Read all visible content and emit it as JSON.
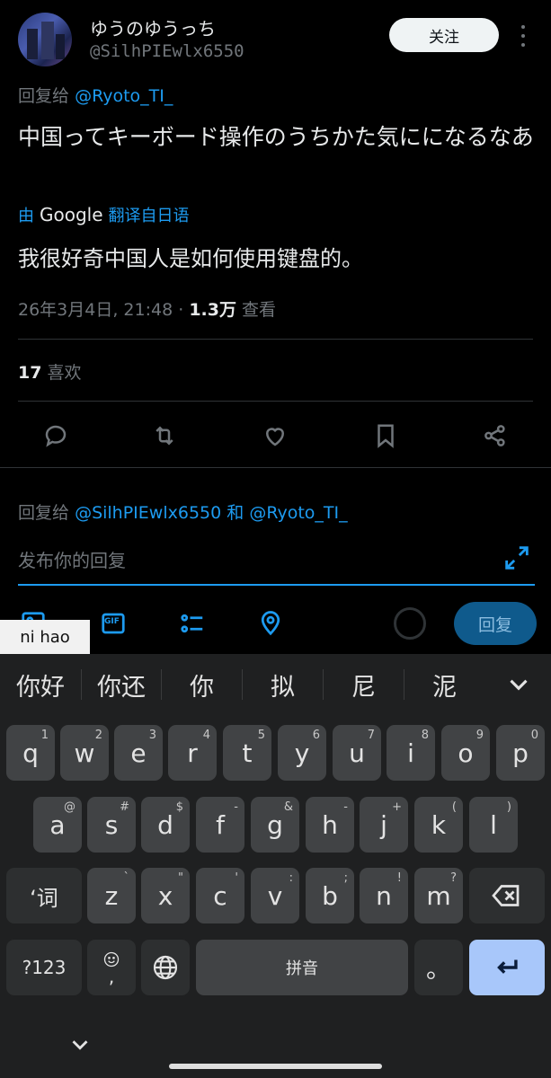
{
  "header": {
    "display_name": "ゆうのゆうっち",
    "handle": "@SilhPIEwlx6550",
    "follow_label": "关注"
  },
  "tweet": {
    "reply_prefix": "回复给",
    "reply_mention": "@Ryoto_TI_",
    "text": "中国ってキーボード操作のうちかた気にになるなあ",
    "translated_by_prefix": "由",
    "translated_by_service": "Google",
    "translated_by_suffix": "翻译自日语",
    "translation": "我很好奇中国人是如何使用键盘的。",
    "timestamp": "26年3月4日, 21:48 · ",
    "views_count": "1.3万",
    "views_label": " 查看",
    "likes_count": "17",
    "likes_label": " 喜欢"
  },
  "reply_box": {
    "reply_prefix": "回复给",
    "mention1": "@SilhPIEwlx6550",
    "joiner": "和",
    "mention2": "@Ryoto_TI_",
    "placeholder": "发布你的回复",
    "gif_label": "GIF",
    "reply_button": "回复"
  },
  "ime": {
    "composition": "ni hao",
    "candidates": [
      "你好",
      "你还",
      "你",
      "拟",
      "尼",
      "泥"
    ],
    "rows": {
      "row1": [
        {
          "k": "q",
          "h": "1"
        },
        {
          "k": "w",
          "h": "2"
        },
        {
          "k": "e",
          "h": "3"
        },
        {
          "k": "r",
          "h": "4"
        },
        {
          "k": "t",
          "h": "5"
        },
        {
          "k": "y",
          "h": "6"
        },
        {
          "k": "u",
          "h": "7"
        },
        {
          "k": "i",
          "h": "8"
        },
        {
          "k": "o",
          "h": "9"
        },
        {
          "k": "p",
          "h": "0"
        }
      ],
      "row2": [
        {
          "k": "a",
          "h": "@"
        },
        {
          "k": "s",
          "h": "#"
        },
        {
          "k": "d",
          "h": "$"
        },
        {
          "k": "f",
          "h": "-"
        },
        {
          "k": "g",
          "h": "&"
        },
        {
          "k": "h",
          "h": "-"
        },
        {
          "k": "j",
          "h": "+"
        },
        {
          "k": "k",
          "h": "("
        },
        {
          "k": "l",
          "h": ")"
        }
      ],
      "row3": [
        {
          "k": "z",
          "h": "`"
        },
        {
          "k": "x",
          "h": "\""
        },
        {
          "k": "c",
          "h": "'"
        },
        {
          "k": "v",
          "h": ":"
        },
        {
          "k": "b",
          "h": ";"
        },
        {
          "k": "n",
          "h": "!"
        },
        {
          "k": "m",
          "h": "?"
        }
      ]
    },
    "shift_label": "‘词",
    "sym_label": "?123",
    "emoji_comma": ",",
    "space_label": "拼音",
    "period_label": "。"
  },
  "icons": [
    "reply-icon",
    "retweet-icon",
    "like-icon",
    "bookmark-icon",
    "share-icon",
    "expand-icon",
    "image-icon",
    "gif-icon",
    "poll-icon",
    "location-icon",
    "backspace-icon",
    "globe-icon",
    "emoji-icon",
    "enter-icon",
    "chevron-down-icon"
  ],
  "colors": {
    "accent": "#1d9bf0",
    "background": "#000000",
    "keyboard": "#1f2021",
    "enter_key": "#a8c7fa"
  }
}
